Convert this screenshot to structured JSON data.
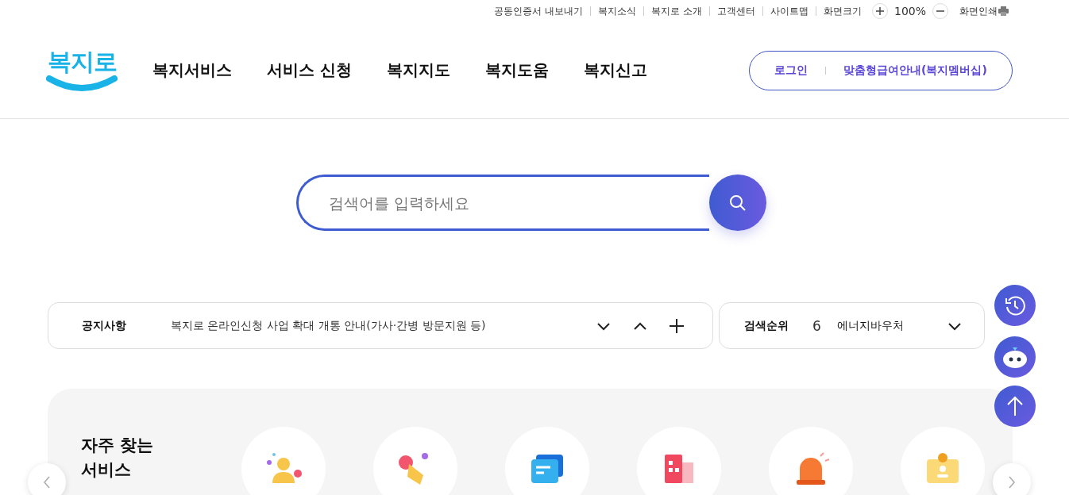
{
  "utility_links": [
    "공동인증서 내보내기",
    "복지소식",
    "복지로 소개",
    "고객센터",
    "사이트맵"
  ],
  "zoom": {
    "label": "화면크기",
    "value": "100%"
  },
  "print": {
    "label": "화면인쇄"
  },
  "logo": {
    "text": "복지로"
  },
  "nav": [
    "복지서비스",
    "서비스 신청",
    "복지지도",
    "복지도움",
    "복지신고"
  ],
  "member_links": [
    "로그인",
    "맞춤형급여안내(복지멤버십)"
  ],
  "search": {
    "placeholder": "검색어를 입력하세요"
  },
  "notice": {
    "label": "공지사항",
    "text": "복지로 온라인신청 사업 확대 개통 안내(가사·간병 방문지원 등)"
  },
  "rank": {
    "label": "검색순위",
    "number": "6",
    "term": "에너지바우처"
  },
  "services": {
    "title": "자주 찾는 서비스",
    "items": [
      {
        "kind": "person"
      },
      {
        "kind": "hand"
      },
      {
        "kind": "chat"
      },
      {
        "kind": "building"
      },
      {
        "kind": "siren"
      },
      {
        "kind": "badge"
      }
    ]
  }
}
